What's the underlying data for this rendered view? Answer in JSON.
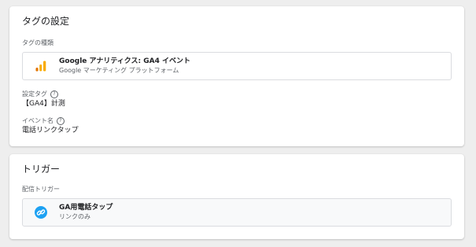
{
  "tag_config": {
    "title": "タグの設定",
    "type_label": "タグの種類",
    "tag_type": {
      "title": "Google アナリティクス: GA4 イベント",
      "subtitle": "Google マーケティング プラットフォーム",
      "icon": "google-analytics-icon"
    },
    "config_tag": {
      "label": "設定タグ",
      "value": "【GA4】計測"
    },
    "event_name": {
      "label": "イベント名",
      "value": "電話リンクタップ"
    },
    "help_glyph": "?"
  },
  "triggering": {
    "title": "トリガー",
    "firing_label": "配信トリガー",
    "trigger": {
      "name": "GA用電話タップ",
      "type": "リンクのみ",
      "icon": "link-icon",
      "icon_color": "#1da1f2"
    }
  }
}
